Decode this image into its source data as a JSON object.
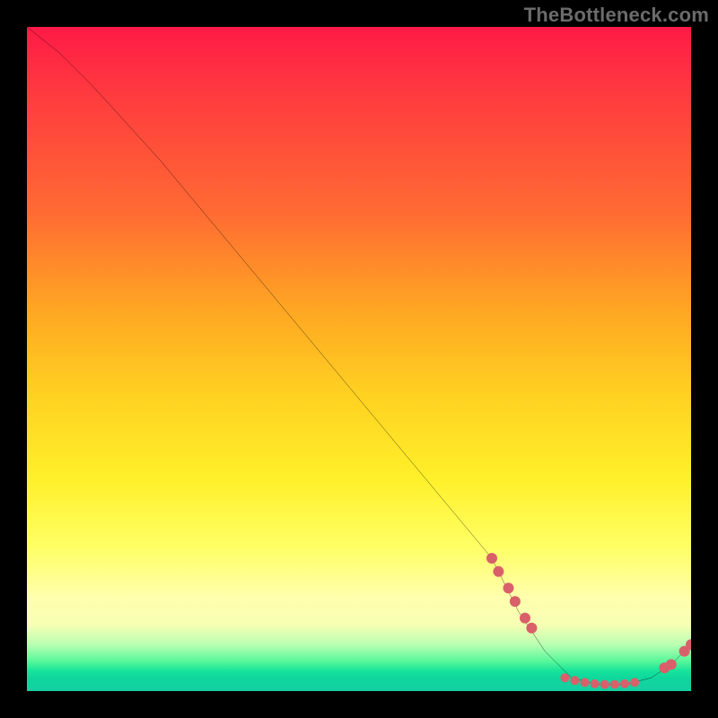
{
  "watermark": "TheBottleneck.com",
  "chart_data": {
    "type": "line",
    "title": "",
    "xlabel": "",
    "ylabel": "",
    "xlim": [
      0,
      100
    ],
    "ylim": [
      0,
      100
    ],
    "grid": false,
    "legend": false,
    "series": [
      {
        "name": "curve",
        "x": [
          0,
          5,
          10,
          20,
          30,
          40,
          50,
          60,
          70,
          74,
          78,
          82,
          86,
          90,
          94,
          97,
          100
        ],
        "y": [
          100,
          96,
          91,
          80,
          68,
          56,
          44,
          32,
          20,
          12,
          6,
          2,
          1,
          1,
          2,
          4,
          7
        ],
        "stroke": "#000000"
      }
    ],
    "markers": [
      {
        "name": "dots-descent",
        "color": "#d9606a",
        "radius_px": 6,
        "points": [
          {
            "x": 70.0,
            "y": 20.0
          },
          {
            "x": 71.0,
            "y": 18.0
          },
          {
            "x": 72.5,
            "y": 15.5
          },
          {
            "x": 73.5,
            "y": 13.5
          },
          {
            "x": 75.0,
            "y": 11.0
          },
          {
            "x": 76.0,
            "y": 9.5
          }
        ]
      },
      {
        "name": "dots-valley",
        "color": "#d9606a",
        "radius_px": 5,
        "points": [
          {
            "x": 81.0,
            "y": 2.0
          },
          {
            "x": 82.5,
            "y": 1.6
          },
          {
            "x": 84.0,
            "y": 1.3
          },
          {
            "x": 85.5,
            "y": 1.1
          },
          {
            "x": 87.0,
            "y": 1.0
          },
          {
            "x": 88.5,
            "y": 1.0
          },
          {
            "x": 90.0,
            "y": 1.1
          },
          {
            "x": 91.5,
            "y": 1.3
          }
        ]
      },
      {
        "name": "dots-rise",
        "color": "#d9606a",
        "radius_px": 6,
        "points": [
          {
            "x": 96.0,
            "y": 3.5
          },
          {
            "x": 97.0,
            "y": 4.0
          },
          {
            "x": 99.0,
            "y": 6.0
          },
          {
            "x": 100.0,
            "y": 7.0
          }
        ]
      }
    ],
    "gradient_bands": [
      {
        "stop": 0.0,
        "color": "#ff1a46"
      },
      {
        "stop": 0.28,
        "color": "#ff6b33"
      },
      {
        "stop": 0.55,
        "color": "#ffd021"
      },
      {
        "stop": 0.78,
        "color": "#ffff63"
      },
      {
        "stop": 0.93,
        "color": "#b9ffb2"
      },
      {
        "stop": 1.0,
        "color": "#14cfa0"
      }
    ]
  }
}
